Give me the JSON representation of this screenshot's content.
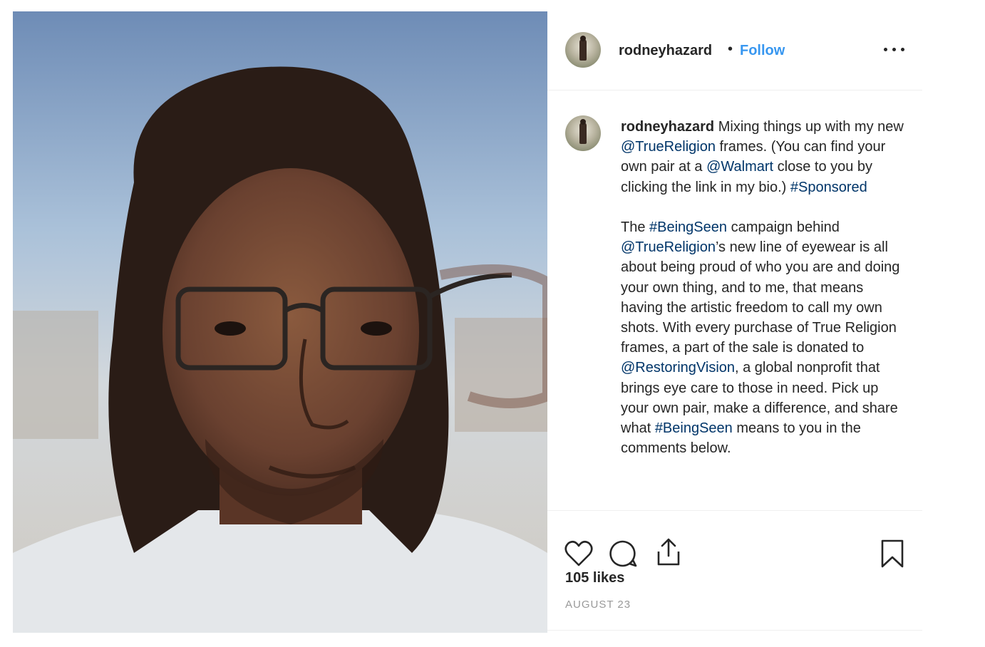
{
  "post": {
    "username": "rodneyhazard",
    "separator": "•",
    "follow_label": "Follow",
    "more_icon": "more-options-icon"
  },
  "caption": {
    "username": "rodneyhazard",
    "segments": [
      {
        "text": " Mixing things up with my new ",
        "type": "text"
      },
      {
        "text": "@TrueReligion",
        "type": "mention"
      },
      {
        "text": " frames. (You can find your own pair at a ",
        "type": "text"
      },
      {
        "text": "@Walmart",
        "type": "mention"
      },
      {
        "text": " close to you by clicking the link in my bio.) ",
        "type": "text"
      },
      {
        "text": "#Sponsored",
        "type": "hashtag"
      },
      {
        "text": "\n\nThe ",
        "type": "text"
      },
      {
        "text": "#BeingSeen",
        "type": "hashtag"
      },
      {
        "text": " campaign behind ",
        "type": "text"
      },
      {
        "text": "@TrueReligion",
        "type": "mention"
      },
      {
        "text": "’s new line of eyewear is all about being proud of who you are and doing your own thing, and to me, that means having the artistic freedom to call my own shots. With every purchase of True Religion frames, a part of the sale is donated to ",
        "type": "text"
      },
      {
        "text": "@RestoringVision",
        "type": "mention"
      },
      {
        "text": ", a global nonprofit that brings eye care to those in need. Pick up your own pair, make a difference, and share what ",
        "type": "text"
      },
      {
        "text": "#BeingSeen",
        "type": "hashtag"
      },
      {
        "text": " means to you in the comments below.",
        "type": "text"
      }
    ]
  },
  "actions": {
    "icons": [
      "heart-icon",
      "comment-icon",
      "share-icon",
      "bookmark-icon"
    ],
    "likes": "105 likes",
    "date": "AUGUST 23"
  },
  "colors": {
    "link_blue": "#3897f0",
    "mention_blue": "#003569",
    "text": "#262626",
    "muted": "#999999",
    "divider": "#efefef"
  }
}
